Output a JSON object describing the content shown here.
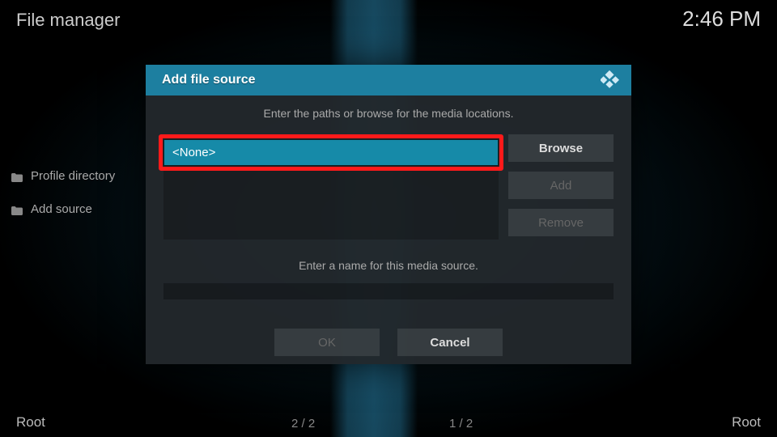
{
  "header": {
    "title": "File manager",
    "time": "2:46 PM"
  },
  "sidebar": {
    "items": [
      {
        "label": "Profile directory"
      },
      {
        "label": "Add source"
      }
    ]
  },
  "status": {
    "left_root": "Root",
    "left_count": "2 / 2",
    "right_count": "1 / 2",
    "right_root": "Root"
  },
  "dialog": {
    "title": "Add file source",
    "paths_instruction": "Enter the paths or browse for the media locations.",
    "selected_path": "<None>",
    "browse_label": "Browse",
    "add_label": "Add",
    "remove_label": "Remove",
    "name_instruction": "Enter a name for this media source.",
    "name_value": "",
    "ok_label": "OK",
    "cancel_label": "Cancel"
  }
}
